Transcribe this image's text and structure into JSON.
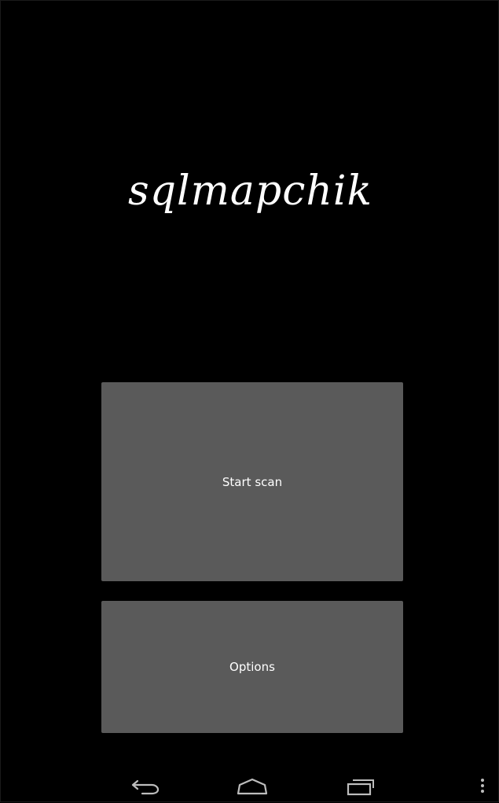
{
  "app": {
    "title": "sqlmapchik"
  },
  "buttons": {
    "start_scan": "Start scan",
    "options": "Options"
  },
  "navbar": {
    "icons": [
      "back-icon",
      "home-icon",
      "recents-icon",
      "overflow-menu-icon"
    ]
  },
  "colors": {
    "background": "#000000",
    "button": "#5a5a5a",
    "text": "#ffffff",
    "nav_icon": "#bdbdbd"
  }
}
